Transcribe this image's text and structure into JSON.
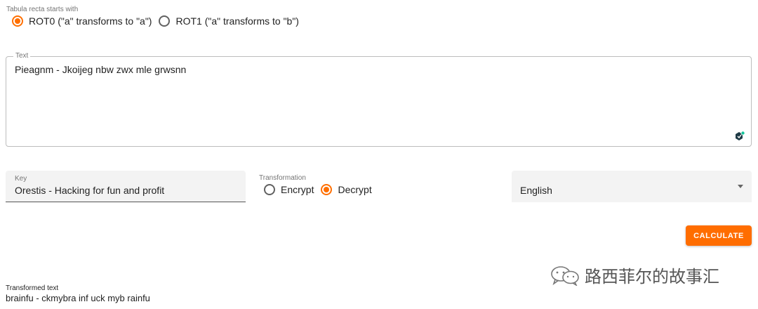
{
  "tabula": {
    "label": "Tabula recta starts with",
    "options": [
      {
        "label": "ROT0 (\"a\" transforms to \"a\")",
        "selected": true
      },
      {
        "label": "ROT1 (\"a\" transforms to \"b\")",
        "selected": false
      }
    ]
  },
  "text_field": {
    "label": "Text",
    "value": "Pieagnm - Jkoijeg nbw zwx mle grwsnn"
  },
  "key_field": {
    "label": "Key",
    "value": "Orestis - Hacking for fun and profit"
  },
  "transformation": {
    "label": "Transformation",
    "options": [
      {
        "label": "Encrypt",
        "selected": false
      },
      {
        "label": "Decrypt",
        "selected": true
      }
    ]
  },
  "language_select": {
    "value": "English"
  },
  "calculate_button": {
    "label": "CALCULATE"
  },
  "watermark": {
    "text": "路西菲尔的故事汇"
  },
  "output": {
    "label": "Transformed text",
    "value": "brainfu - ckmybra inf uck myb rainfu"
  },
  "colors": {
    "accent": "#ff6d00",
    "radio_accent": "#ff6f00"
  }
}
